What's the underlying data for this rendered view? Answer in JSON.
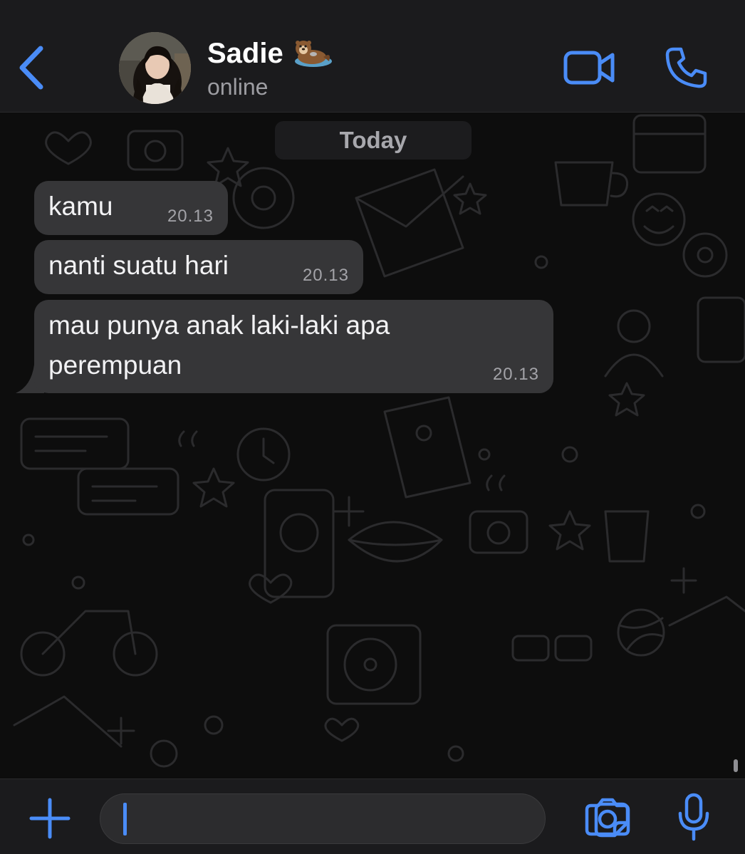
{
  "colors": {
    "accent": "#4a8cf7",
    "header_bg": "#1b1b1d",
    "chat_bg": "#0d0d0d",
    "bubble_bg": "#363638",
    "text_primary": "#f2f2f4",
    "text_secondary": "#a3a3a8"
  },
  "header": {
    "back_icon": "chevron-left-icon",
    "contact_name": "Sadie",
    "contact_emoji": "otter-emoji",
    "status": "online",
    "video_icon": "video-camera-icon",
    "call_icon": "phone-icon"
  },
  "chat": {
    "date_label": "Today",
    "messages": [
      {
        "text": "kamu",
        "time": "20.13",
        "direction": "incoming"
      },
      {
        "text": "nanti suatu hari",
        "time": "20.13",
        "direction": "incoming"
      },
      {
        "text": "mau punya anak laki-laki apa perempuan",
        "time": "20.13",
        "direction": "incoming"
      }
    ]
  },
  "input_bar": {
    "plus_icon": "plus-icon",
    "message_value": "",
    "sticker_icon": "sticker-icon",
    "camera_icon": "camera-icon",
    "mic_icon": "microphone-icon"
  }
}
